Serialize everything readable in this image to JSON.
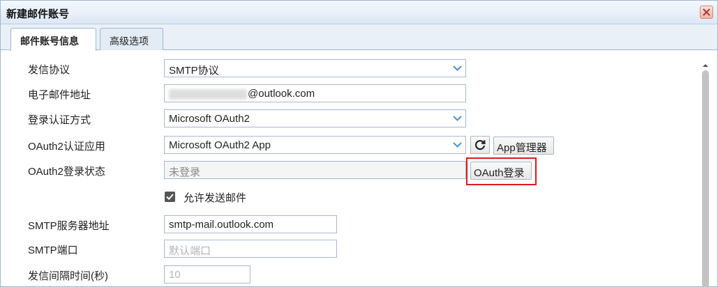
{
  "window": {
    "title": "新建邮件账号"
  },
  "tabs": [
    {
      "label": "邮件账号信息",
      "active": true
    },
    {
      "label": "高级选项",
      "active": false
    }
  ],
  "form": {
    "protocol": {
      "label": "发信协议",
      "value": "SMTP协议"
    },
    "email": {
      "label": "电子邮件地址",
      "domain": "@outlook.com"
    },
    "auth_method": {
      "label": "登录认证方式",
      "value": "Microsoft OAuth2"
    },
    "oauth_app": {
      "label": "OAuth2认证应用",
      "value": "Microsoft OAuth2 App",
      "manager_button": "App管理器"
    },
    "oauth_status": {
      "label": "OAuth2登录状态",
      "value": "未登录",
      "login_button": "OAuth登录"
    },
    "allow_send": {
      "label": "允许发送邮件",
      "checked": true
    },
    "smtp_server": {
      "label": "SMTP服务器地址",
      "value": "smtp-mail.outlook.com"
    },
    "smtp_port": {
      "label": "SMTP端口",
      "placeholder": "默认端口"
    },
    "send_interval": {
      "label": "发信间隔时间(秒)",
      "placeholder": "10"
    }
  },
  "icons": {
    "close": "close-icon",
    "dropdown": "chevron-down-icon",
    "refresh": "refresh-icon",
    "check": "check-icon"
  },
  "colors": {
    "highlight": "#e0181f",
    "accent": "#4a90d9"
  }
}
